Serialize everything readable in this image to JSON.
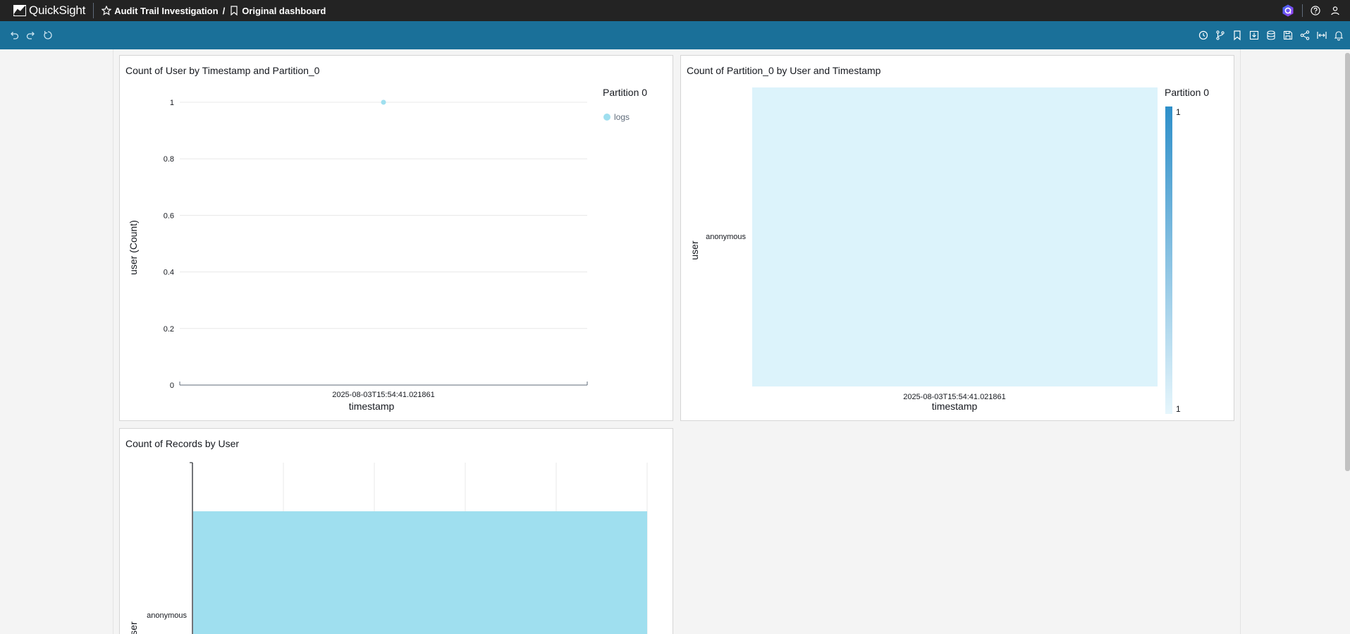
{
  "app": {
    "name": "QuickSight"
  },
  "breadcrumb": {
    "analysis": "Audit Trail Investigation",
    "separator": "/",
    "dashboard": "Original dashboard"
  },
  "colors": {
    "topbar": "#232323",
    "toolbar": "#1a7099",
    "series": "#9fdfef",
    "heat_cell": "#dcf3fb",
    "accent": "#2e8fc9"
  },
  "icons": {
    "toolbar_left": [
      "undo-icon",
      "redo-icon",
      "reset-icon"
    ],
    "toolbar_right": [
      "history-icon",
      "branch-icon",
      "bookmark-icon",
      "download-icon",
      "dataset-icon",
      "save-icon",
      "share-icon",
      "fit-width-icon",
      "bell-icon"
    ],
    "top_right": [
      "q-badge-icon",
      "help-icon",
      "user-icon"
    ]
  },
  "visuals": [
    {
      "title": "Count of User by Timestamp and Partition_0",
      "chart_data": {
        "type": "line",
        "x": [
          "2025-08-03T15:54:41.021861"
        ],
        "series": [
          {
            "name": "logs",
            "values": [
              1
            ]
          }
        ],
        "xlabel": "timestamp",
        "ylabel": "user (Count)",
        "yticks": [
          "1",
          "0.8",
          "0.6",
          "0.4",
          "0.2",
          "0"
        ],
        "ylim": [
          0,
          1
        ],
        "legend_title": "Partition 0",
        "legend_placement": "right",
        "grid": true
      }
    },
    {
      "title": "Count of Partition_0 by User and Timestamp",
      "chart_data": {
        "type": "heatmap",
        "x": [
          "2025-08-03T15:54:41.021861"
        ],
        "y": [
          "anonymous"
        ],
        "values": [
          [
            1
          ]
        ],
        "xlabel": "timestamp",
        "ylabel": "user",
        "legend_title": "Partition 0",
        "legend_max": "1",
        "legend_min": "1",
        "legend_placement": "right"
      }
    },
    {
      "title": "Count of Records by User",
      "chart_data": {
        "type": "bar",
        "orientation": "horizontal",
        "categories": [
          "anonymous"
        ],
        "values": [
          1
        ],
        "ylabel": "user",
        "grid": true
      }
    }
  ]
}
